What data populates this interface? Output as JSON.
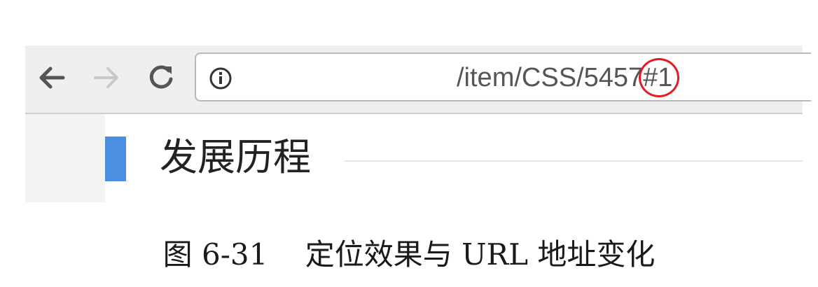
{
  "browser": {
    "url_path": "/item/CSS/5457",
    "url_hash": "#1",
    "highlight_color": "#e21b24",
    "icons": {
      "back": "arrow-left-icon",
      "forward": "arrow-right-icon",
      "reload": "reload-icon",
      "info": "info-icon"
    }
  },
  "page": {
    "section_title": "发展历程",
    "accent_color": "#4a8fe2"
  },
  "caption": "图 6-31    定位效果与 URL 地址变化"
}
